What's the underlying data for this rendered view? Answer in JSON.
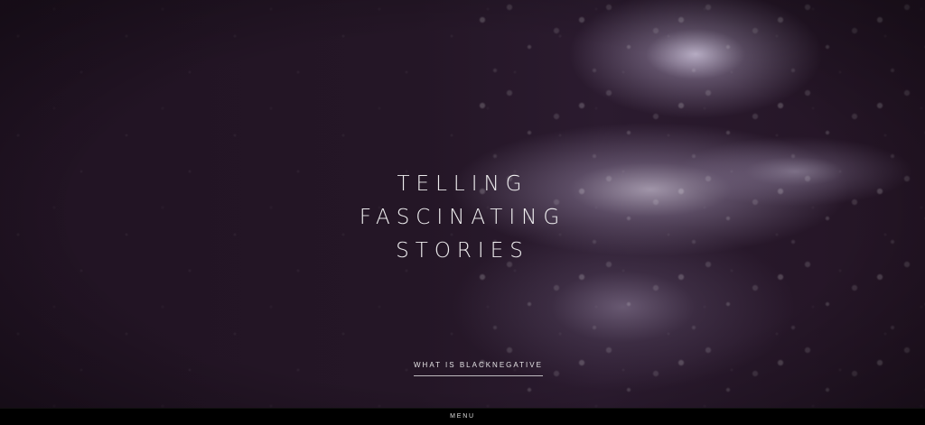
{
  "hero": {
    "headline_lines": [
      "TELLING",
      "FASCINATING",
      "STORIES"
    ],
    "cta_label": "WHAT IS BLACKNEGATIVE"
  },
  "footer": {
    "menu_label": "MENU"
  }
}
